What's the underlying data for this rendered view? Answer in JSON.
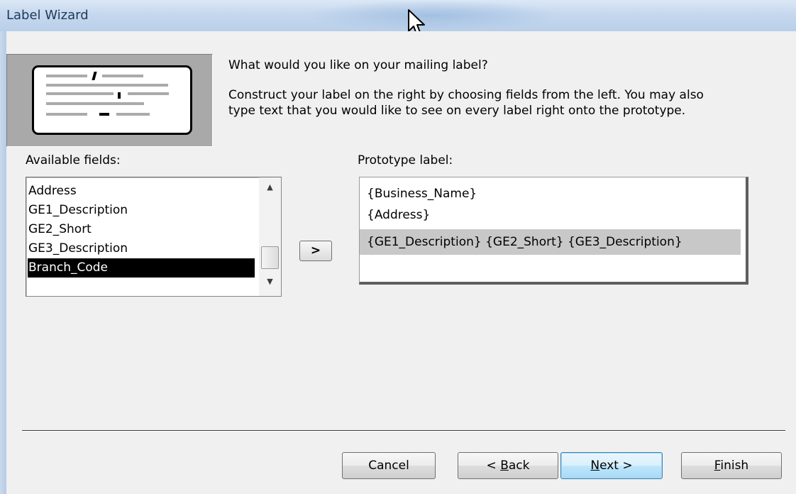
{
  "window": {
    "title": "Label Wizard"
  },
  "instructions": {
    "question": "What would you like on your mailing label?",
    "line1": "Construct your label on the right by choosing fields from the left. You may also",
    "line2": "type text that you would like to see on every label right onto the prototype."
  },
  "available_fields": {
    "label": "Available fields:",
    "items": [
      {
        "text": "Address",
        "selected": false
      },
      {
        "text": "GE1_Description",
        "selected": false
      },
      {
        "text": "GE2_Short",
        "selected": false
      },
      {
        "text": "GE3_Description",
        "selected": false
      },
      {
        "text": "Branch_Code",
        "selected": true
      }
    ]
  },
  "move_button": {
    "label": ">"
  },
  "prototype": {
    "label": "Prototype label:",
    "lines": [
      {
        "text": "{Business_Name}",
        "highlighted": false
      },
      {
        "text": "{Address}",
        "highlighted": false
      },
      {
        "text": "{GE1_Description} {GE2_Short} {GE3_Description}",
        "highlighted": true
      }
    ]
  },
  "buttons": {
    "cancel": "Cancel",
    "back_prefix": "< ",
    "back_mnemonic": "B",
    "back_rest": "ack",
    "next_mnemonic": "N",
    "next_rest": "ext >",
    "finish_mnemonic": "F",
    "finish_rest": "inish"
  },
  "colors": {
    "titlebar": "#c6d8ee",
    "dialog_bg": "#f0f0f0",
    "selected_item_bg": "#000000",
    "highlighted_line_bg": "#c8c8c8"
  },
  "icons": [
    "arrow-cursor-icon",
    "scroll-up-arrow-icon",
    "scroll-down-arrow-icon",
    "label-illustration-icon"
  ]
}
